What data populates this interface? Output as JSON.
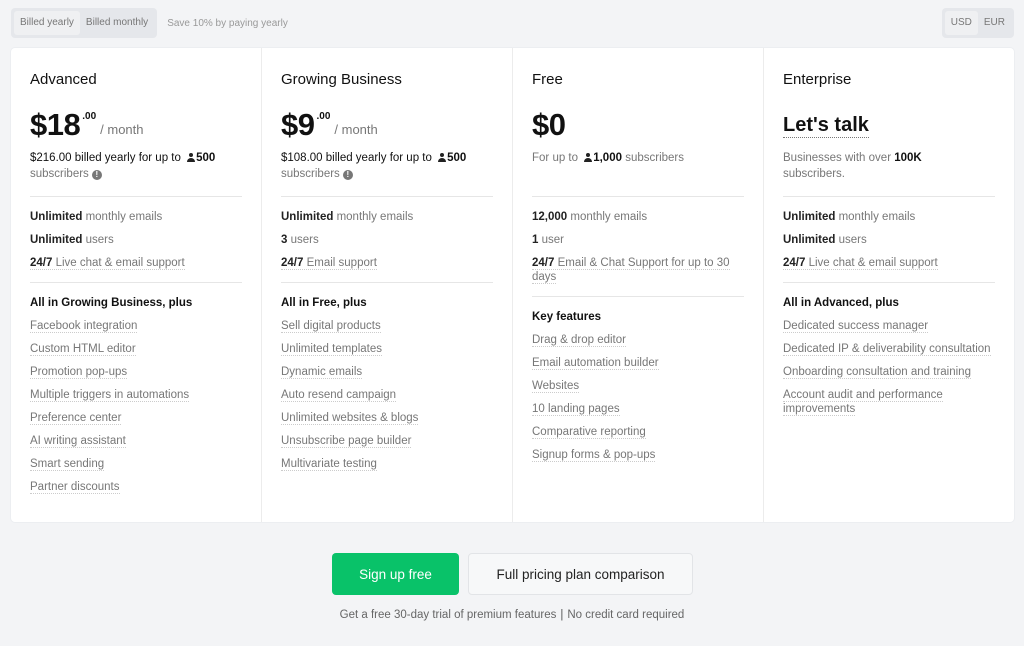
{
  "billing_toggle": {
    "options": [
      "Billed yearly",
      "Billed monthly"
    ],
    "active": "Billed yearly",
    "save_note": "Save 10% by paying yearly"
  },
  "currency_toggle": {
    "options": [
      "USD",
      "EUR"
    ],
    "active": "USD"
  },
  "plans": [
    {
      "name": "Advanced",
      "price": "$18",
      "cents": ".00",
      "period": "/ month",
      "billing_amount": "$216.00 billed yearly",
      "billing_mid": " for up to ",
      "subscribers": "500",
      "subscribers_label": "subscribers",
      "basics": [
        {
          "bold": "Unlimited",
          "text": " monthly emails"
        },
        {
          "bold": "Unlimited",
          "text": " users"
        },
        {
          "bold": "24/7",
          "text": " Live chat & email support"
        }
      ],
      "features_heading": "All in Growing Business, plus",
      "features": [
        "Facebook integration",
        "Custom HTML editor",
        "Promotion pop-ups",
        "Multiple triggers in automations",
        "Preference center",
        "AI writing assistant",
        "Smart sending",
        "Partner discounts"
      ]
    },
    {
      "name": "Growing Business",
      "price": "$9",
      "cents": ".00",
      "period": "/ month",
      "billing_amount": "$108.00 billed yearly",
      "billing_mid": " for up to ",
      "subscribers": "500",
      "subscribers_label": "subscribers",
      "basics": [
        {
          "bold": "Unlimited",
          "text": " monthly emails"
        },
        {
          "bold": "3",
          "text": " users"
        },
        {
          "bold": "24/7",
          "text": " Email support"
        }
      ],
      "features_heading": "All in Free, plus",
      "features": [
        "Sell digital products",
        "Unlimited templates",
        "Dynamic emails",
        "Auto resend campaign",
        "Unlimited websites & blogs",
        "Unsubscribe page builder",
        "Multivariate testing"
      ]
    },
    {
      "name": "Free",
      "price": "$0",
      "sub_prefix": "For up to ",
      "subscribers": "1,000",
      "subscribers_label": " subscribers",
      "basics": [
        {
          "bold": "12,000",
          "text": " monthly emails"
        },
        {
          "bold": "1",
          "text": " user"
        },
        {
          "bold": "24/7",
          "text": " Email & Chat Support for up to 30 days"
        }
      ],
      "features_heading": "Key features",
      "features": [
        "Drag & drop editor",
        "Email automation builder",
        "Websites",
        "10 landing pages",
        "Comparative reporting",
        "Signup forms & pop-ups"
      ]
    },
    {
      "name": "Enterprise",
      "price": "Let's talk",
      "sub_prefix": "Businesses with over ",
      "subscribers": "100K",
      "subscribers_label": "subscribers.",
      "basics": [
        {
          "bold": "Unlimited",
          "text": " monthly emails"
        },
        {
          "bold": "Unlimited",
          "text": " users"
        },
        {
          "bold": "24/7",
          "text": " Live chat & email support"
        }
      ],
      "features_heading": "All in Advanced, plus",
      "features": [
        "Dedicated success manager",
        "Dedicated IP & deliverability consultation",
        "Onboarding consultation and training",
        "Account audit and performance improvements"
      ]
    }
  ],
  "cta": {
    "primary": "Sign up free",
    "secondary": "Full pricing plan comparison",
    "note_left": "Get a free 30-day trial of premium features",
    "note_sep": "|",
    "note_right": "No credit card required"
  },
  "colors": {
    "accent": "#09c269",
    "background": "#f3f4f6"
  }
}
